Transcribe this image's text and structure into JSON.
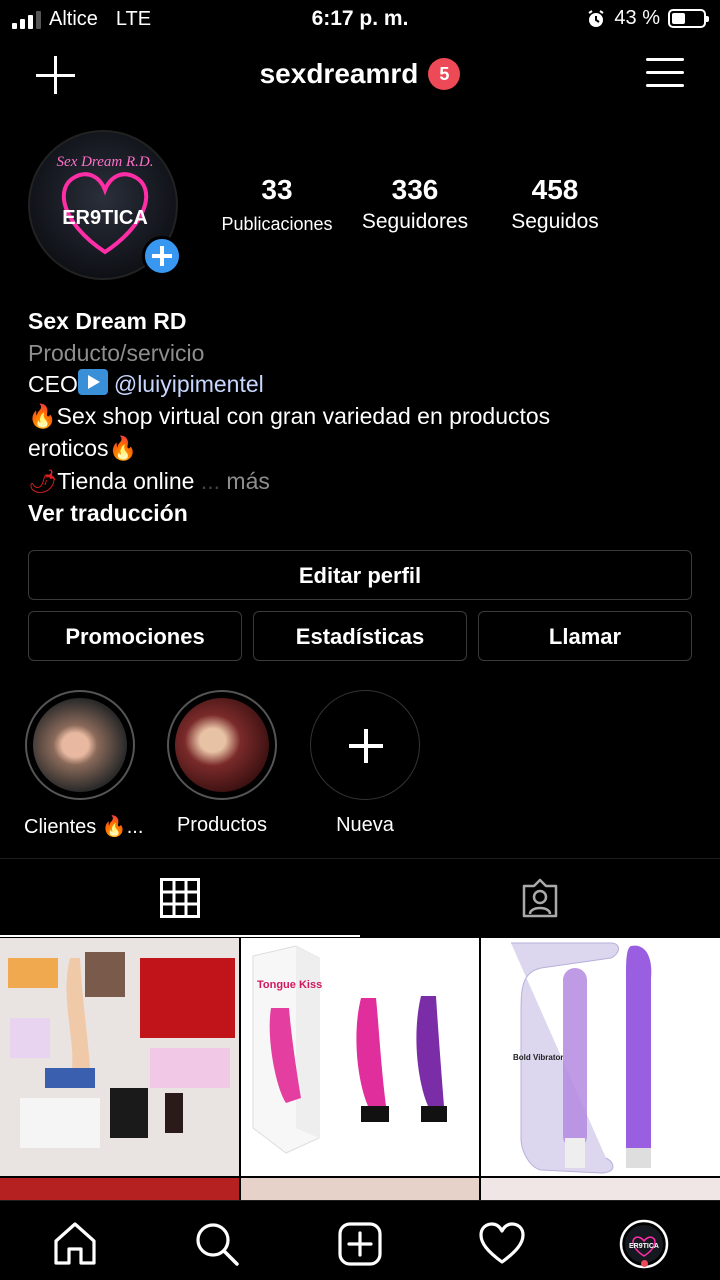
{
  "status_bar": {
    "carrier": "Altice",
    "network": "LTE",
    "time": "6:17 p. m.",
    "battery": "43 %",
    "battery_level": 0.43
  },
  "header": {
    "username": "sexdreamrd",
    "notification_count": "5",
    "new_post_icon": "plus-icon",
    "menu_icon": "hamburger-menu-icon"
  },
  "profile": {
    "avatar_text_top": "Sex Dream R.D.",
    "avatar_text_main": "ER9TICA",
    "stats": [
      {
        "value": "33",
        "label": "Publicaciones"
      },
      {
        "value": "336",
        "label": "Seguidores"
      },
      {
        "value": "458",
        "label": "Seguidos"
      }
    ]
  },
  "bio": {
    "name": "Sex Dream RD",
    "category": "Producto/servicio",
    "line1_prefix": "CEO",
    "line1_link": "@luiyipimentel",
    "line2_emoji_start": "🔥",
    "line2_text": "Sex shop virtual con gran variedad en productos",
    "line3_text": "eroticos",
    "line3_emoji_end": "🔥",
    "line4_emoji": "🌶",
    "line4_text": "Tienda online",
    "more_ellipsis": "...",
    "more": "más",
    "translate": "Ver traducción"
  },
  "buttons": {
    "edit_profile": "Editar perfil",
    "promotions": "Promociones",
    "insights": "Estadísticas",
    "call": "Llamar"
  },
  "highlights": [
    {
      "label": "Clientes 🔥..."
    },
    {
      "label": "Productos"
    },
    {
      "label": "Nueva"
    }
  ],
  "tabs": [
    {
      "name": "grid",
      "icon": "grid-icon",
      "active": true
    },
    {
      "name": "tagged",
      "icon": "tagged-person-icon",
      "active": false
    }
  ],
  "grid_posts": {
    "post2_text": "Tongue Kiss",
    "post3_text": "Bold Vibrator"
  },
  "bottom_nav": [
    {
      "name": "home",
      "icon": "home-icon"
    },
    {
      "name": "search",
      "icon": "search-icon"
    },
    {
      "name": "create",
      "icon": "add-post-icon"
    },
    {
      "name": "activity",
      "icon": "heart-icon"
    },
    {
      "name": "profile",
      "icon": "profile-avatar-icon"
    }
  ],
  "colors": {
    "background": "#000000",
    "badge": "#ed4956",
    "accent_blue": "#3897f0",
    "secondary_text": "#8e8e8e"
  }
}
